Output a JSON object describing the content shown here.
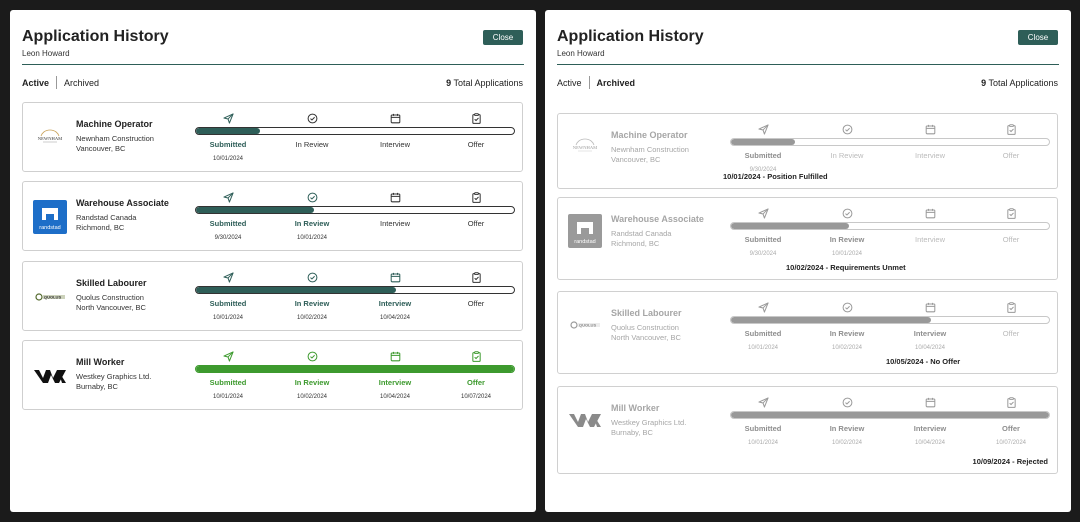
{
  "panels": [
    {
      "title": "Application History",
      "user": "Leon Howard",
      "close_label": "Close",
      "tabs": [
        "Active",
        "Archived"
      ],
      "active_tab": "Active",
      "total_count": "9",
      "total_label": "Total Applications",
      "applications": [
        {
          "title": "Machine Operator",
          "company": "Newnham Construction",
          "location": "Vancouver, BC",
          "logo": "newnham-logo",
          "progress": 0.2,
          "stages": [
            {
              "label": "Submitted",
              "date": "10/01/2024",
              "state": "done"
            },
            {
              "label": "In Review",
              "date": "",
              "state": "todo"
            },
            {
              "label": "Interview",
              "date": "",
              "state": "todo"
            },
            {
              "label": "Offer",
              "date": "",
              "state": "todo"
            }
          ]
        },
        {
          "title": "Warehouse Associate",
          "company": "Randstad Canada",
          "location": "Richmond, BC",
          "logo": "randstad-logo",
          "progress": 0.37,
          "stages": [
            {
              "label": "Submitted",
              "date": "9/30/2024",
              "state": "done"
            },
            {
              "label": "In Review",
              "date": "10/01/2024",
              "state": "done"
            },
            {
              "label": "Interview",
              "date": "",
              "state": "todo"
            },
            {
              "label": "Offer",
              "date": "",
              "state": "todo"
            }
          ]
        },
        {
          "title": "Skilled Labourer",
          "company": "Quolus Construction",
          "location": "North Vancouver, BC",
          "logo": "quolus-logo",
          "progress": 0.63,
          "stages": [
            {
              "label": "Submitted",
              "date": "10/01/2024",
              "state": "done"
            },
            {
              "label": "In Review",
              "date": "10/02/2024",
              "state": "done"
            },
            {
              "label": "Interview",
              "date": "10/04/2024",
              "state": "done"
            },
            {
              "label": "Offer",
              "date": "",
              "state": "todo"
            }
          ]
        },
        {
          "title": "Mill Worker",
          "company": "Westkey Graphics Ltd.",
          "location": "Burnaby, BC",
          "logo": "westkey-logo",
          "progress": 1.0,
          "complete": true,
          "stages": [
            {
              "label": "Submitted",
              "date": "10/01/2024",
              "state": "done"
            },
            {
              "label": "In Review",
              "date": "10/02/2024",
              "state": "done"
            },
            {
              "label": "Interview",
              "date": "10/04/2024",
              "state": "done"
            },
            {
              "label": "Offer",
              "date": "10/07/2024",
              "state": "done"
            }
          ]
        }
      ]
    },
    {
      "title": "Application History",
      "user": "Leon Howard",
      "close_label": "Close",
      "tabs": [
        "Active",
        "Archived"
      ],
      "active_tab": "Archived",
      "total_count": "9",
      "total_label": "Total Applications",
      "applications": [
        {
          "title": "Machine Operator",
          "company": "Newnham Construction",
          "location": "Vancouver, BC",
          "logo": "newnham-logo",
          "progress": 0.2,
          "status": "10/01/2024 - Position Fulfilled",
          "stages": [
            {
              "label": "Submitted",
              "date": "9/30/2024",
              "state": "done"
            },
            {
              "label": "In Review",
              "date": "",
              "state": "todo"
            },
            {
              "label": "Interview",
              "date": "",
              "state": "todo"
            },
            {
              "label": "Offer",
              "date": "",
              "state": "todo"
            }
          ]
        },
        {
          "title": "Warehouse Associate",
          "company": "Randstad Canada",
          "location": "Richmond, BC",
          "logo": "randstad-logo",
          "progress": 0.37,
          "status": "10/02/2024 - Requirements Unmet",
          "stages": [
            {
              "label": "Submitted",
              "date": "9/30/2024",
              "state": "done"
            },
            {
              "label": "In Review",
              "date": "10/01/2024",
              "state": "done"
            },
            {
              "label": "Interview",
              "date": "",
              "state": "todo"
            },
            {
              "label": "Offer",
              "date": "",
              "state": "todo"
            }
          ]
        },
        {
          "title": "Skilled Labourer",
          "company": "Quolus Construction",
          "location": "North Vancouver, BC",
          "logo": "quolus-logo",
          "progress": 0.63,
          "status": "10/05/2024 - No Offer",
          "stages": [
            {
              "label": "Submitted",
              "date": "10/01/2024",
              "state": "done"
            },
            {
              "label": "In Review",
              "date": "10/02/2024",
              "state": "done"
            },
            {
              "label": "Interview",
              "date": "10/04/2024",
              "state": "done"
            },
            {
              "label": "Offer",
              "date": "",
              "state": "todo"
            }
          ]
        },
        {
          "title": "Mill Worker",
          "company": "Westkey Graphics Ltd.",
          "location": "Burnaby, BC",
          "logo": "westkey-logo",
          "progress": 1.0,
          "status": "10/09/2024 - Rejected",
          "stages": [
            {
              "label": "Submitted",
              "date": "10/01/2024",
              "state": "done"
            },
            {
              "label": "In Review",
              "date": "10/02/2024",
              "state": "done"
            },
            {
              "label": "Interview",
              "date": "10/04/2024",
              "state": "done"
            },
            {
              "label": "Offer",
              "date": "10/07/2024",
              "state": "done"
            }
          ]
        }
      ]
    }
  ],
  "colors": {
    "brand": "#2e5e58",
    "complete": "#3d9a2e",
    "archived": "#999999"
  },
  "stage_icons": [
    "send-icon",
    "check-circle-icon",
    "calendar-icon",
    "clipboard-check-icon"
  ]
}
